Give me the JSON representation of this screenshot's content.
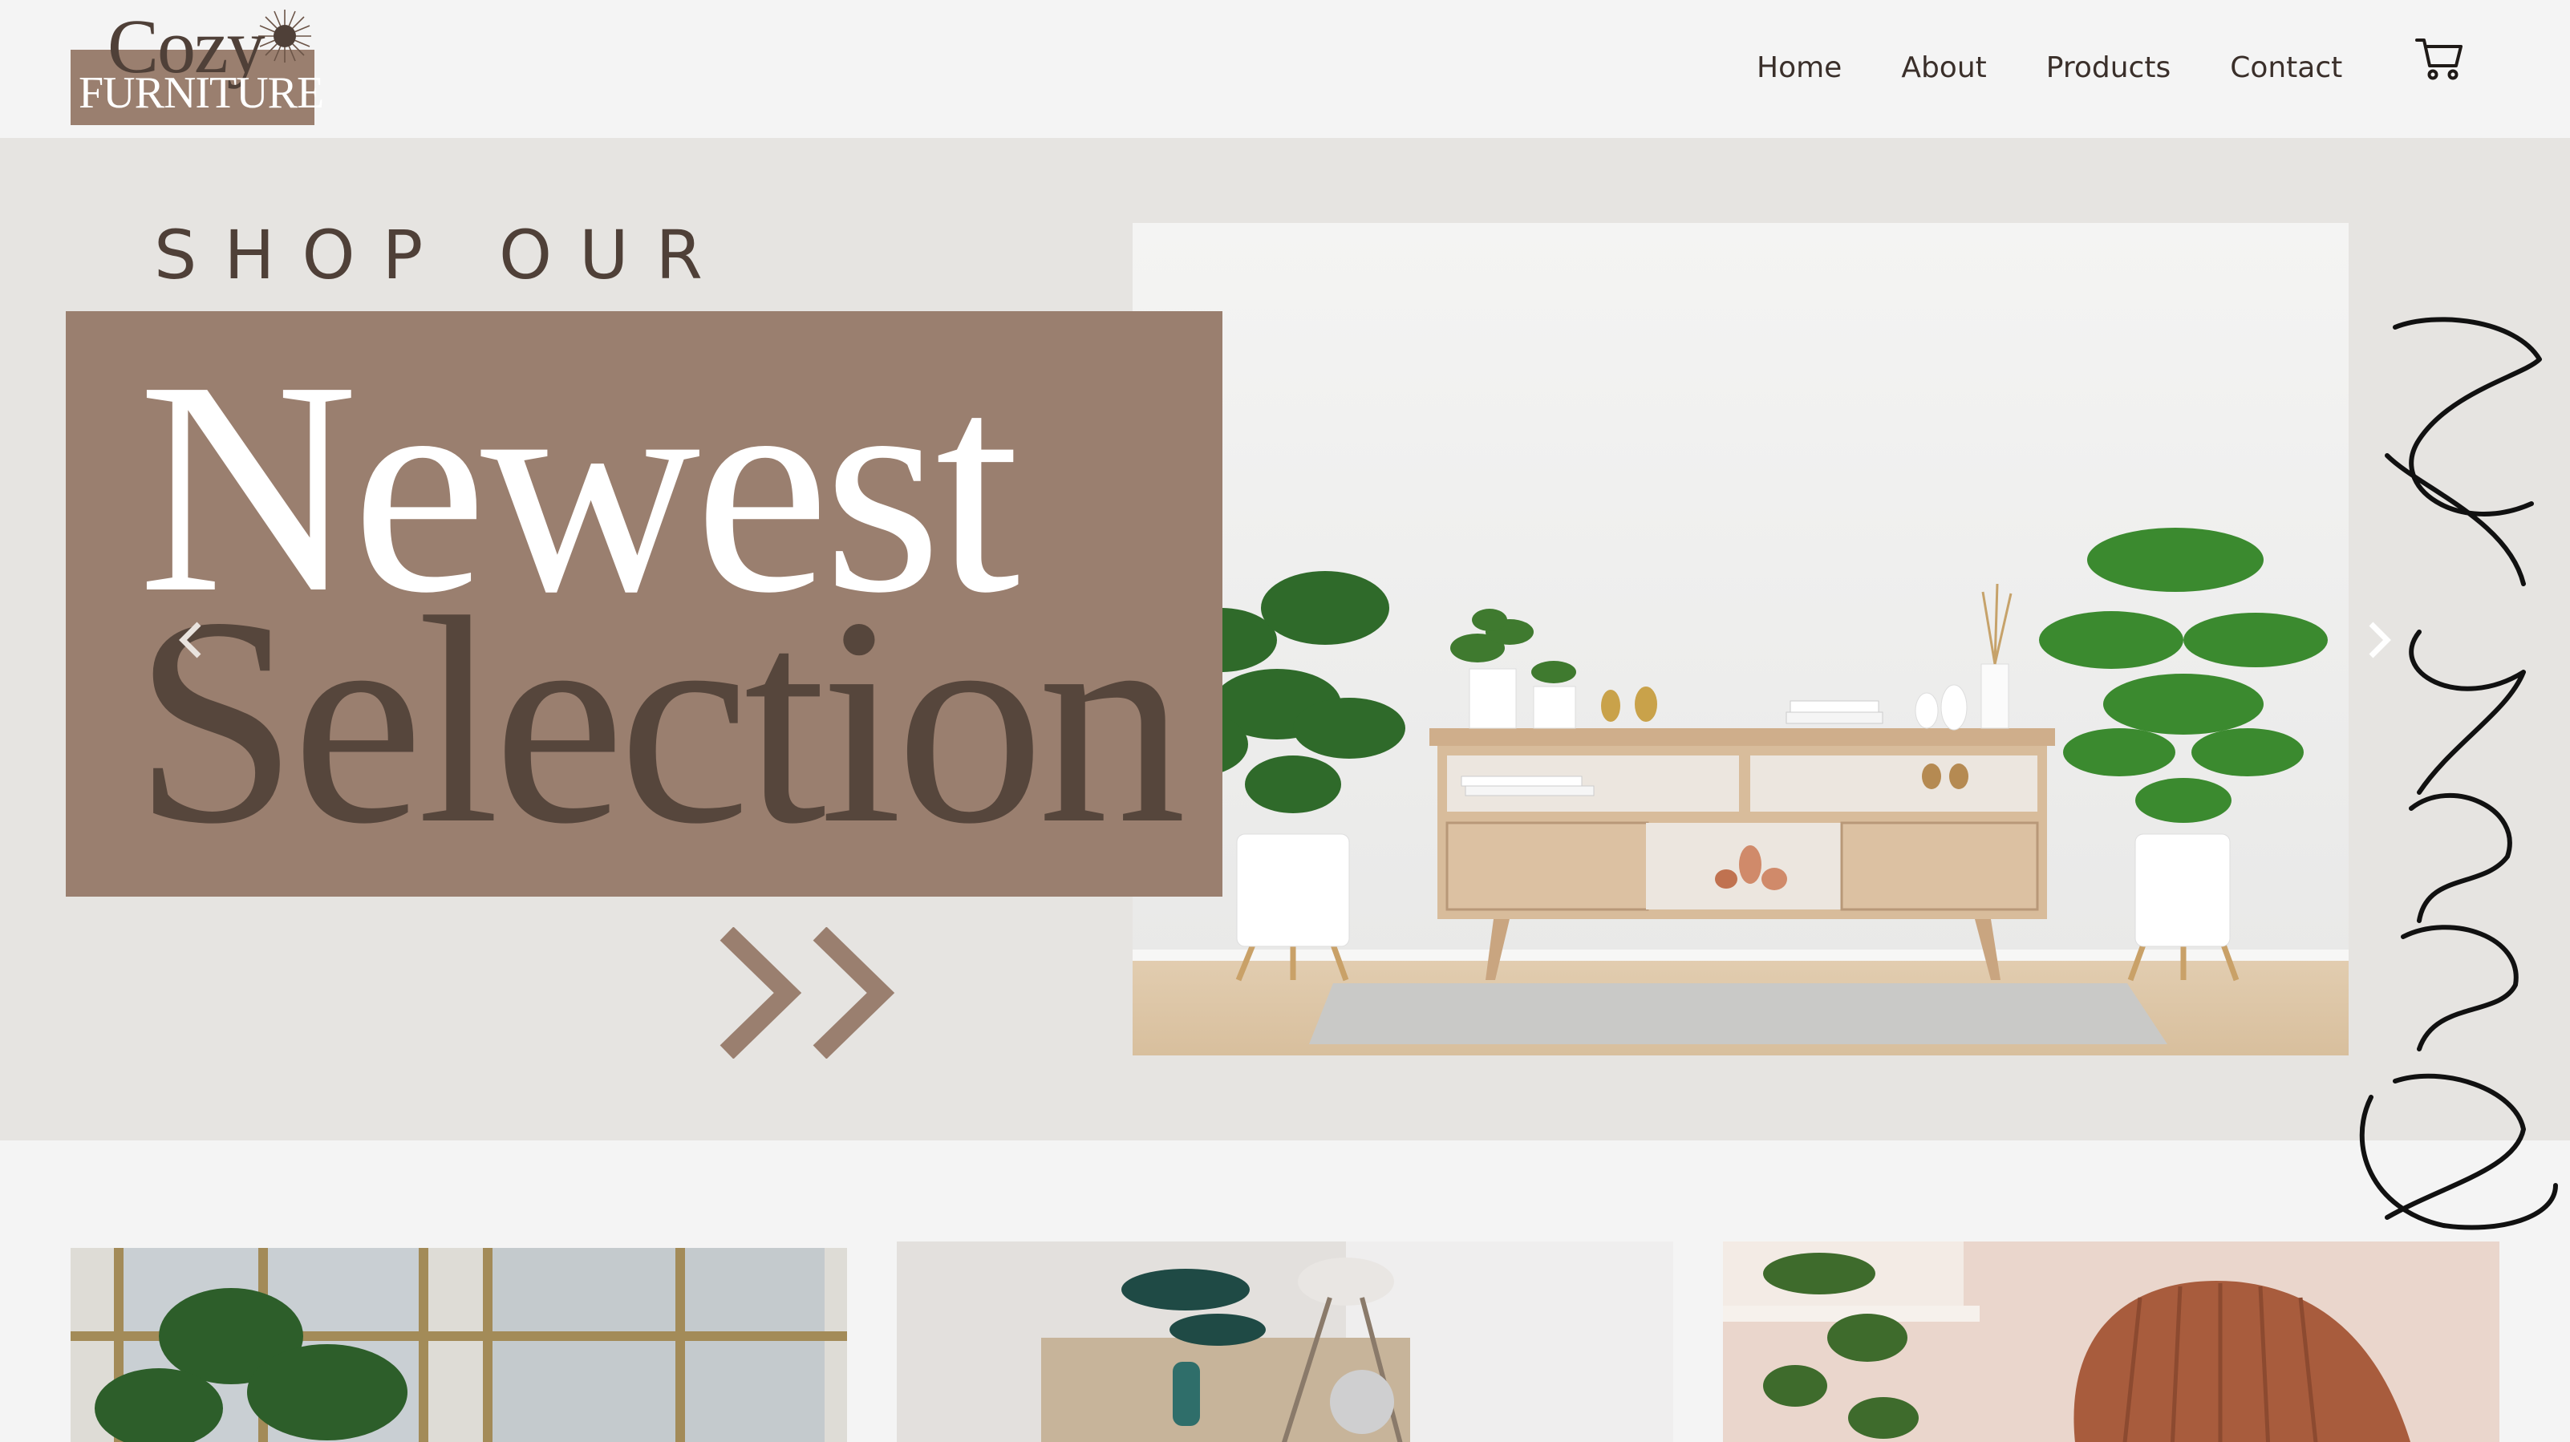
{
  "brand": {
    "logo_top": "Cozy",
    "logo_bottom": "FURNITURE",
    "brand_color": "#9a7f6f",
    "dark_color": "#4f4038"
  },
  "nav": {
    "items": [
      {
        "label": "Home"
      },
      {
        "label": "About"
      },
      {
        "label": "Products"
      },
      {
        "label": "Contact"
      }
    ],
    "cart_icon": "shopping-cart-icon"
  },
  "hero": {
    "eyebrow": "SHOP OUR",
    "title_line1": "Newest",
    "title_line2": "Selection",
    "side_script": "Exclusive Deal",
    "cta_icon": "double-chevron-right-icon",
    "prev_icon": "chevron-left-icon",
    "next_icon": "chevron-right-icon",
    "hero_bg": "#e6e4e1"
  },
  "cards": [
    {
      "alt": "Window with monstera plant"
    },
    {
      "alt": "Dining table with plant"
    },
    {
      "alt": "Leather chair with hanging plant"
    }
  ]
}
